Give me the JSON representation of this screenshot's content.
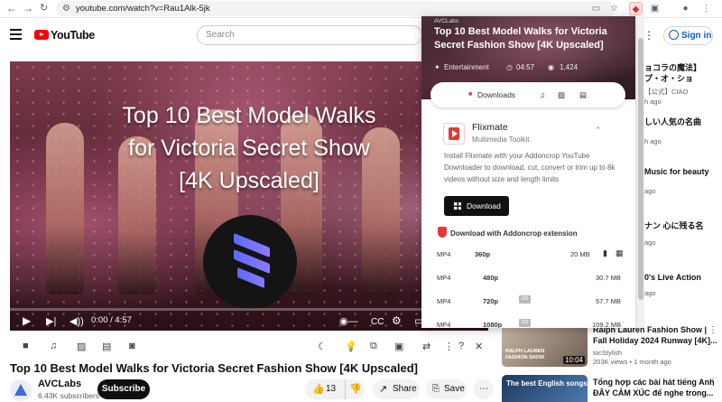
{
  "browser": {
    "url": "youtube.com/watch?v=Rau1Alk-5jk"
  },
  "header": {
    "logo_text": "YouTube",
    "search_placeholder": "Search",
    "sign_in": "Sign in"
  },
  "video": {
    "overlay_title_lines": [
      "Top 10 Best Model Walks",
      "for Victoria Secret Show",
      "[4K Upscaled]"
    ],
    "time": "0:00 / 4:57"
  },
  "below_video": {
    "title": "Top 10 Best Model Walks for Victoria Secret Fashion Show [4K Upscaled]",
    "channel": "AVCLabs",
    "subscribers": "6.43K subscribers",
    "subscribe": "Subscribe",
    "likes": "13",
    "share": "Share",
    "save": "Save"
  },
  "popup": {
    "small_label": "AVCLabs",
    "title": "Top 10 Best Model Walks for Victoria Secret Fashion Show [4K Upscaled]",
    "category": "Entertainment",
    "duration": "04:57",
    "views": "1,424",
    "tab_downloads": "Downloads",
    "app_name": "Flixmate",
    "app_sub": "Multimedia Toolkit",
    "description": "Install Flixmate with your Addoncrop YouTube Downloader to download, cut, convert or trim up to 8k videos without size and length limits",
    "download_button": "Download",
    "section_title": "Download with Addoncrop extension",
    "rows": [
      {
        "format": "MP4",
        "quality": "360p",
        "hd": "",
        "size": "20 MB"
      },
      {
        "format": "MP4",
        "quality": "480p",
        "hd": "",
        "size": "30.7 MB"
      },
      {
        "format": "MP4",
        "quality": "720p",
        "hd": "HD",
        "size": "57.7 MB"
      },
      {
        "format": "MP4",
        "quality": "1080p",
        "hd": "HD",
        "size": "109.2 MB"
      }
    ]
  },
  "sidebar": {
    "partial": [
      {
        "title": "ョコラの魔法】",
        "title2": "プ・オ・ショ",
        "meta": "【公式】CIAO"
      },
      {
        "meta": "h ago"
      },
      {
        "title": "しい人気の名曲",
        "meta": "h ago"
      },
      {
        "title": "Music for beauty",
        "meta": "ago"
      },
      {
        "title": "ナン 心に残る名",
        "meta": "ago"
      },
      {
        "title": "0's Live Action",
        "meta": "ago"
      }
    ],
    "full": [
      {
        "title": "Ralph Lauren Fashion Show |",
        "title2": "Fall Holiday 2024 Runway [4K]...",
        "channel": "tocStylish",
        "meta": "203K views • 1 month ago",
        "duration": "10:04",
        "thumb_text": "RALPH LAUREN FASHION SHOW"
      },
      {
        "title": "Tổng hợp các bài hát tiếng Anh",
        "title2": "ĐÂY CẢM XÚC để nghe trong...",
        "thumb_text": "The best English songs"
      }
    ]
  }
}
